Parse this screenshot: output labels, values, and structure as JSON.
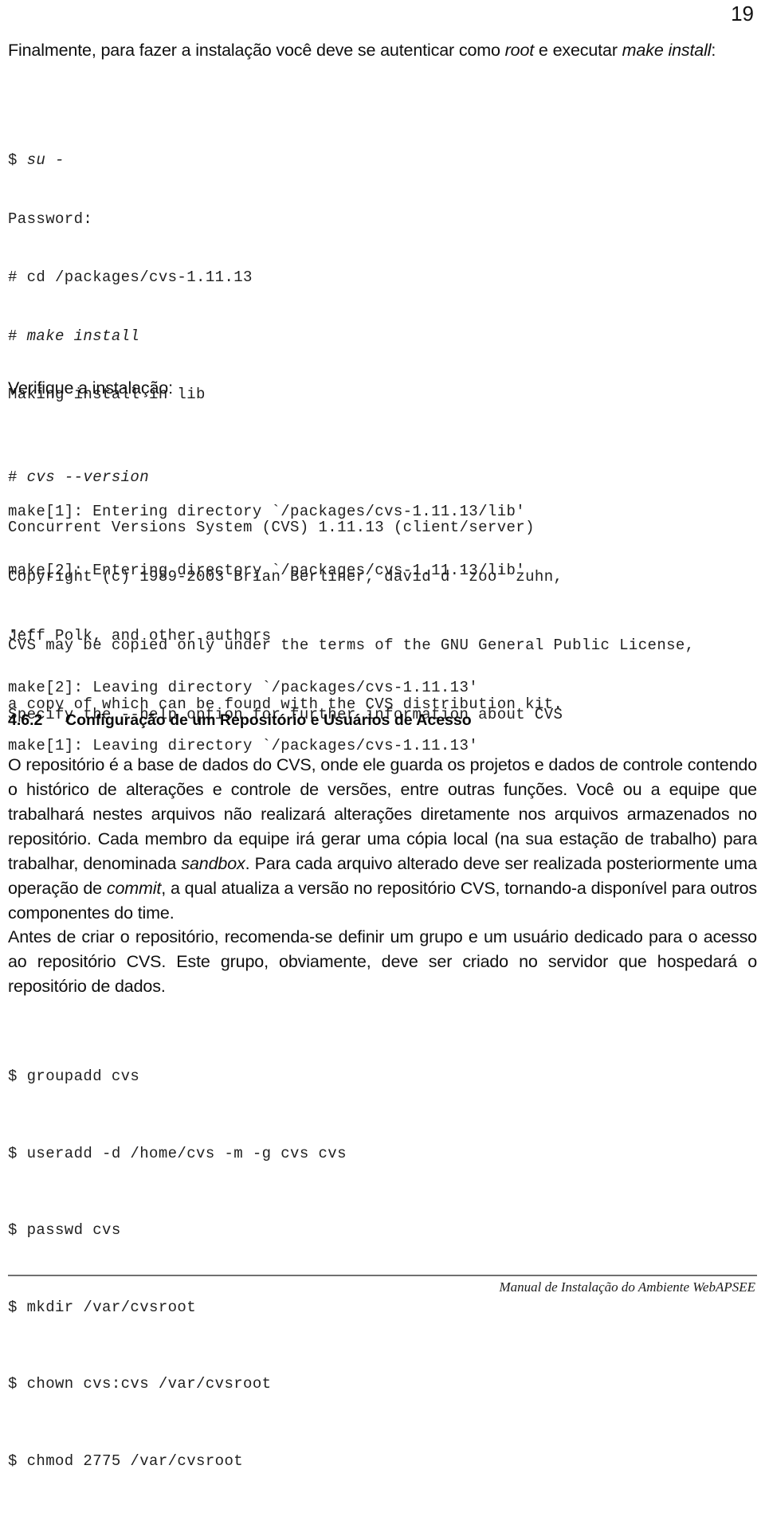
{
  "page": {
    "number": "19"
  },
  "intro": {
    "text_before": "Finalmente, para fazer a instalação você deve se autenticar como ",
    "em1": "root",
    "text_mid": " e executar ",
    "em2": "make install",
    "text_after": ":"
  },
  "install_log": {
    "line1_prompt": "$ ",
    "line1_cmd": "su -",
    "line2": "Password:",
    "line3": "# cd /packages/cvs-1.11.13",
    "line4_prompt": "# ",
    "line4_cmd": "make install",
    "line5": "Making install in lib",
    "line6": "make[1]: Entering directory `/packages/cvs-1.11.13/lib'",
    "line7": "make[2]: Entering directory `/packages/cvs-1.11.13/lib'",
    "line8": "...",
    "line9": "make[2]: Leaving directory `/packages/cvs-1.11.13'",
    "line10": "make[1]: Leaving directory `/packages/cvs-1.11.13'"
  },
  "verify": {
    "label": "Verifique a instalação:",
    "cmd_prompt": "# ",
    "cmd": "cvs --version",
    "out1": "Concurrent Versions System (CVS) 1.11.13 (client/server)",
    "out2": "Copyright (c) 1989-2003 Brian Berliner, david d `zoo' zuhn,",
    "out3": "Jeff Polk, and other authors",
    "out4": "CVS may be copied only under the terms of the GNU General Public License,",
    "out5": "a copy of which can be found with the CVS distribution kit.",
    "out6": "Specify the --help option for further information about CVS"
  },
  "section": {
    "number": "4.6.2",
    "title": "Configuração de um Repositório e Usuários de Acesso"
  },
  "paragraph1": {
    "p1": "O repositório é a base de dados do CVS, onde ele guarda os projetos e dados de controle contendo o histórico de alterações e controle de versões, entre outras funções. Você ou a equipe que trabalhará nestes arquivos não realizará alterações diretamente nos arquivos armazenados no repositório. Cada membro da equipe irá gerar uma cópia local (na sua estação de trabalho) para trabalhar, denominada ",
    "em1": "sandbox",
    "p2": ". Para cada arquivo alterado deve ser realizada posteriormente uma operação de ",
    "em2": "commit",
    "p3": ", a qual atualiza a versão no repositório CVS, tornando-a disponível para outros componentes do time."
  },
  "paragraph2": {
    "text": "Antes de criar o repositório, recomenda-se definir um grupo e um usuário dedicado para o acesso ao repositório CVS. Este grupo, obviamente, deve ser criado no servidor que hospedará o repositório de dados."
  },
  "commands": {
    "c1": "$ groupadd cvs",
    "c2": "$ useradd -d /home/cvs -m -g cvs cvs",
    "c3": "$ passwd cvs",
    "c4": "$ mkdir /var/cvsroot",
    "c5": "$ chown cvs:cvs /var/cvsroot",
    "c6": "$ chmod 2775 /var/cvsroot"
  },
  "footer": {
    "text": "Manual de Instalação do Ambiente WebAPSEE"
  }
}
